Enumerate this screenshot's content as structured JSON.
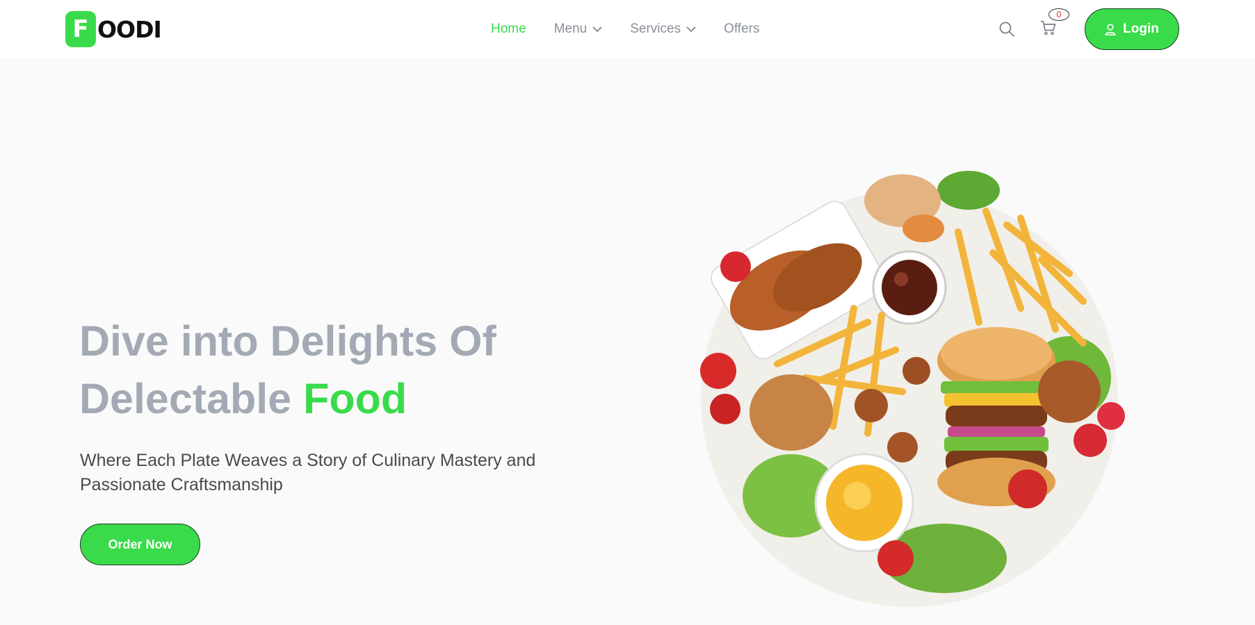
{
  "brand": {
    "logo_letter": "F",
    "logo_rest": "OODI",
    "accent_color": "#39DB4A",
    "text_color": "#111111"
  },
  "nav": {
    "items": [
      {
        "label": "Home",
        "active": true,
        "dropdown": false
      },
      {
        "label": "Menu",
        "active": false,
        "dropdown": true
      },
      {
        "label": "Services",
        "active": false,
        "dropdown": true
      },
      {
        "label": "Offers",
        "active": false,
        "dropdown": false
      }
    ],
    "search_icon": "search-icon",
    "cart_icon": "cart-icon",
    "cart_count": "0",
    "login_label": "Login",
    "login_icon": "user-icon"
  },
  "hero": {
    "title_line1": "Dive into Delights Of",
    "title_line2": "Delectable",
    "title_accent": "Food",
    "subtitle": "Where Each Plate Weaves a Story of Culinary Mastery and Passionate Craftsmanship",
    "cta_label": "Order Now",
    "image": "food-platter-image"
  },
  "colors": {
    "title_gray": "#a3aab5",
    "nav_gray": "#8a8f98",
    "hero_bg": "#fafafa"
  }
}
